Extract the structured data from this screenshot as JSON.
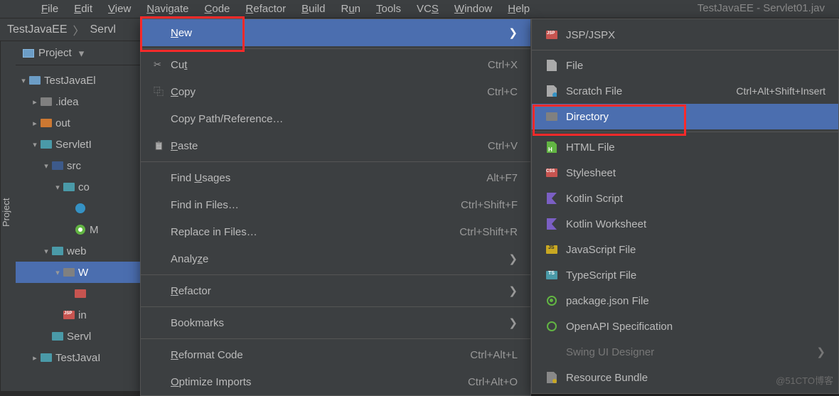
{
  "menubar": [
    {
      "label": "File",
      "ul": "F"
    },
    {
      "label": "Edit",
      "ul": "E"
    },
    {
      "label": "View",
      "ul": "V"
    },
    {
      "label": "Navigate",
      "ul": "N"
    },
    {
      "label": "Code",
      "ul": "C"
    },
    {
      "label": "Refactor",
      "ul": "R"
    },
    {
      "label": "Build",
      "ul": "B"
    },
    {
      "label": "Run",
      "ul": "u"
    },
    {
      "label": "Tools",
      "ul": "T"
    },
    {
      "label": "VCS",
      "ul": "S"
    },
    {
      "label": "Window",
      "ul": "W"
    },
    {
      "label": "Help",
      "ul": "H"
    }
  ],
  "title_trail": "TestJavaEE - Servlet01.jav",
  "breadcrumb": {
    "a": "TestJavaEE",
    "b": "Servl"
  },
  "project_header": "Project",
  "side_tab": "Project",
  "tree": [
    {
      "indent": 0,
      "arrow": "down",
      "icon": "folder-blue",
      "label": "TestJavaEl"
    },
    {
      "indent": 1,
      "arrow": "right",
      "icon": "folder-gray",
      "label": ".idea"
    },
    {
      "indent": 1,
      "arrow": "right",
      "icon": "folder-orange",
      "label": "out"
    },
    {
      "indent": 1,
      "arrow": "down",
      "icon": "folder-cyan",
      "label": "ServletI"
    },
    {
      "indent": 2,
      "arrow": "down",
      "icon": "folder-darkblue",
      "label": "src"
    },
    {
      "indent": 3,
      "arrow": "down",
      "icon": "folder-cyan",
      "label": "co"
    },
    {
      "indent": 4,
      "arrow": "",
      "icon": "circle-cyan",
      "label": ""
    },
    {
      "indent": 4,
      "arrow": "",
      "icon": "circle-green",
      "label": "M"
    },
    {
      "indent": 2,
      "arrow": "down",
      "icon": "folder-cyan",
      "label": "web"
    },
    {
      "indent": 3,
      "arrow": "down",
      "icon": "folder-gray",
      "label": "W",
      "sel": true
    },
    {
      "indent": 4,
      "arrow": "",
      "icon": "xml-ico",
      "label": ""
    },
    {
      "indent": 3,
      "arrow": "",
      "icon": "jsp-ico",
      "label": "in"
    },
    {
      "indent": 2,
      "arrow": "",
      "icon": "folder-cyan",
      "label": "Servl"
    },
    {
      "indent": 1,
      "arrow": "right",
      "icon": "folder-cyan",
      "label": "TestJavaI"
    }
  ],
  "context": [
    {
      "type": "item",
      "icon": "",
      "label": "New",
      "ul": "N",
      "arrow": true,
      "highlight": true
    },
    {
      "type": "sep"
    },
    {
      "type": "item",
      "icon": "scissors",
      "label": "Cut",
      "ul": "t",
      "shortcut": "Ctrl+X"
    },
    {
      "type": "item",
      "icon": "copy-ico",
      "label": "Copy",
      "ul": "C",
      "shortcut": "Ctrl+C"
    },
    {
      "type": "item",
      "icon": "",
      "label": "Copy Path/Reference…"
    },
    {
      "type": "item",
      "icon": "paste-ico",
      "label": "Paste",
      "ul": "P",
      "shortcut": "Ctrl+V"
    },
    {
      "type": "sep"
    },
    {
      "type": "item",
      "icon": "",
      "label": "Find Usages",
      "ul": "U",
      "shortcut": "Alt+F7"
    },
    {
      "type": "item",
      "icon": "",
      "label": "Find in Files…",
      "shortcut": "Ctrl+Shift+F"
    },
    {
      "type": "item",
      "icon": "",
      "label": "Replace in Files…",
      "shortcut": "Ctrl+Shift+R"
    },
    {
      "type": "item",
      "icon": "",
      "label": "Analyze",
      "ul": "z",
      "arrow": true
    },
    {
      "type": "sep"
    },
    {
      "type": "item",
      "icon": "",
      "label": "Refactor",
      "ul": "R",
      "arrow": true
    },
    {
      "type": "sep"
    },
    {
      "type": "item",
      "icon": "",
      "label": "Bookmarks",
      "arrow": true
    },
    {
      "type": "sep"
    },
    {
      "type": "item",
      "icon": "",
      "label": "Reformat Code",
      "ul": "R",
      "shortcut": "Ctrl+Alt+L"
    },
    {
      "type": "item",
      "icon": "",
      "label": "Optimize Imports",
      "ul": "O",
      "shortcut": "Ctrl+Alt+O"
    }
  ],
  "submenu": [
    {
      "type": "item",
      "icon": "jsp-ico",
      "label": "JSP/JSPX"
    },
    {
      "type": "sep"
    },
    {
      "type": "item",
      "icon": "file-ico",
      "label": "File"
    },
    {
      "type": "item",
      "icon": "scratch-ico",
      "label": "Scratch File",
      "shortcut": "Ctrl+Alt+Shift+Insert"
    },
    {
      "type": "item",
      "icon": "folder-gray",
      "label": "Directory",
      "highlight": true
    },
    {
      "type": "sep"
    },
    {
      "type": "item",
      "icon": "html-ico",
      "label": "HTML File"
    },
    {
      "type": "item",
      "icon": "css-ico",
      "label": "Stylesheet"
    },
    {
      "type": "item",
      "icon": "kt-ico",
      "label": "Kotlin Script"
    },
    {
      "type": "item",
      "icon": "kt-ico",
      "label": "Kotlin Worksheet"
    },
    {
      "type": "item",
      "icon": "js-ico",
      "label": "JavaScript File"
    },
    {
      "type": "item",
      "icon": "ts-ico",
      "label": "TypeScript File"
    },
    {
      "type": "item",
      "icon": "json-ico",
      "label": "package.json File"
    },
    {
      "type": "item",
      "icon": "api-ico",
      "label": "OpenAPI Specification"
    },
    {
      "type": "item",
      "icon": "",
      "label": "Swing UI Designer",
      "disabled": true,
      "arrow": true
    },
    {
      "type": "item",
      "icon": "bundle-ico",
      "label": "Resource Bundle"
    }
  ],
  "watermark": "@51CTO博客"
}
